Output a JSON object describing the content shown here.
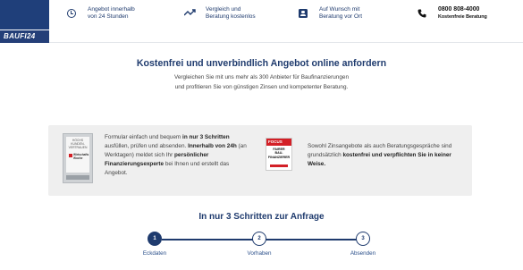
{
  "header": {
    "logo_text": "BAUFI24",
    "items": [
      {
        "icon": "clock-icon",
        "line1": "Angebot innerhalb",
        "line2": "von 24 Stunden"
      },
      {
        "icon": "trend-arrow-icon",
        "line1": "Vergleich und",
        "line2": "Beratung kostenlos"
      },
      {
        "icon": "person-icon",
        "line1": "Auf Wunsch mit",
        "line2": "Beratung vor Ort"
      }
    ],
    "phone": {
      "number": "0800 808-4000",
      "caption": "Kostenfreie Beratung"
    }
  },
  "intro": {
    "title": "Kostenfrei und unverbindlich Angebot online anfordern",
    "line1": "Vergleichen Sie mit uns mehr als 300 Anbieter für Baufinanzierungen",
    "line2": "und profitieren Sie von günstigen Zinsen und kompetenter Beratung."
  },
  "info": {
    "badge1": {
      "top": "HÖCHS KUNDEN-VERTRAUEN",
      "brand": "Wirtschafts Woche"
    },
    "text1": {
      "a": "Formular einfach und bequem ",
      "b": "in nur 3 Schritten",
      "c": " ausfüllen, prüfen und absenden. ",
      "d": "Innerhalb von 24h",
      "e": " (an Werktagen) meldet sich Ihr ",
      "f": "persönlicher Finanzierungsexperte",
      "g": " bei Ihnen und erstellt das Angebot."
    },
    "badge2": {
      "top": "FOCUS",
      "l1": "FAIRER",
      "l2": "BAU-",
      "l3": "FINANZIERER"
    },
    "text2": {
      "a": "Sowohl Zinsangebote als auch Beratungsgespräche sind grundsätzlich ",
      "b": "kostenfrei und verpflichten Sie in keiner Weise."
    }
  },
  "steps": {
    "title": "In nur 3 Schritten zur Anfrage",
    "items": [
      {
        "number": "1",
        "label": "Eckdaten"
      },
      {
        "number": "2",
        "label": "Vorhaben"
      },
      {
        "number": "3",
        "label": "Absenden"
      }
    ]
  },
  "colors": {
    "primary": "#1f3b6e",
    "accent_red": "#d32027",
    "box_bg": "#efefef"
  }
}
